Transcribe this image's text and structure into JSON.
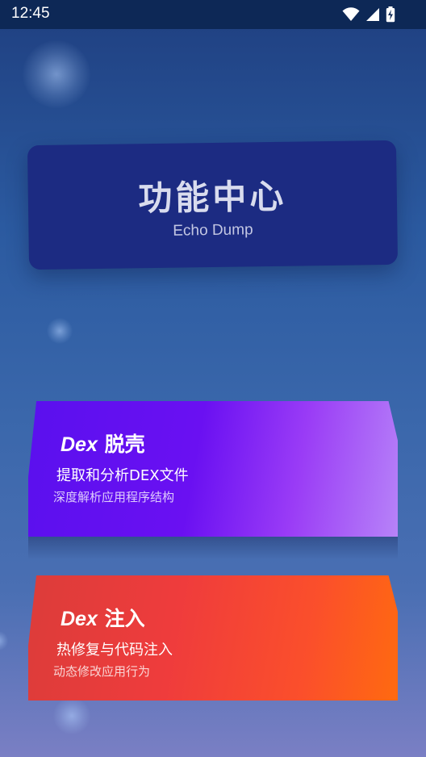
{
  "status_bar": {
    "time": "12:45",
    "icons": [
      "wifi-icon",
      "signal-icon",
      "battery-charging-icon"
    ]
  },
  "header": {
    "title": "功能中心",
    "subtitle": "Echo Dump"
  },
  "features": [
    {
      "title_en": "Dex",
      "title_cn": "脱壳",
      "subtitle": "提取和分析DEX文件",
      "description": "深度解析应用程序结构",
      "gradient": [
        "#5a10ee",
        "#b783f8"
      ]
    },
    {
      "title_en": "Dex",
      "title_cn": "注入",
      "subtitle": "热修复与代码注入",
      "description": "动态修改应用行为",
      "gradient": [
        "#dc3c3a",
        "#ff6a10"
      ]
    }
  ],
  "colors": {
    "status_bar_bg": "#0d2856",
    "header_card_bg": "#1c2b82",
    "background_top": "#1f3f80",
    "background_bottom": "#7a7fc4"
  }
}
